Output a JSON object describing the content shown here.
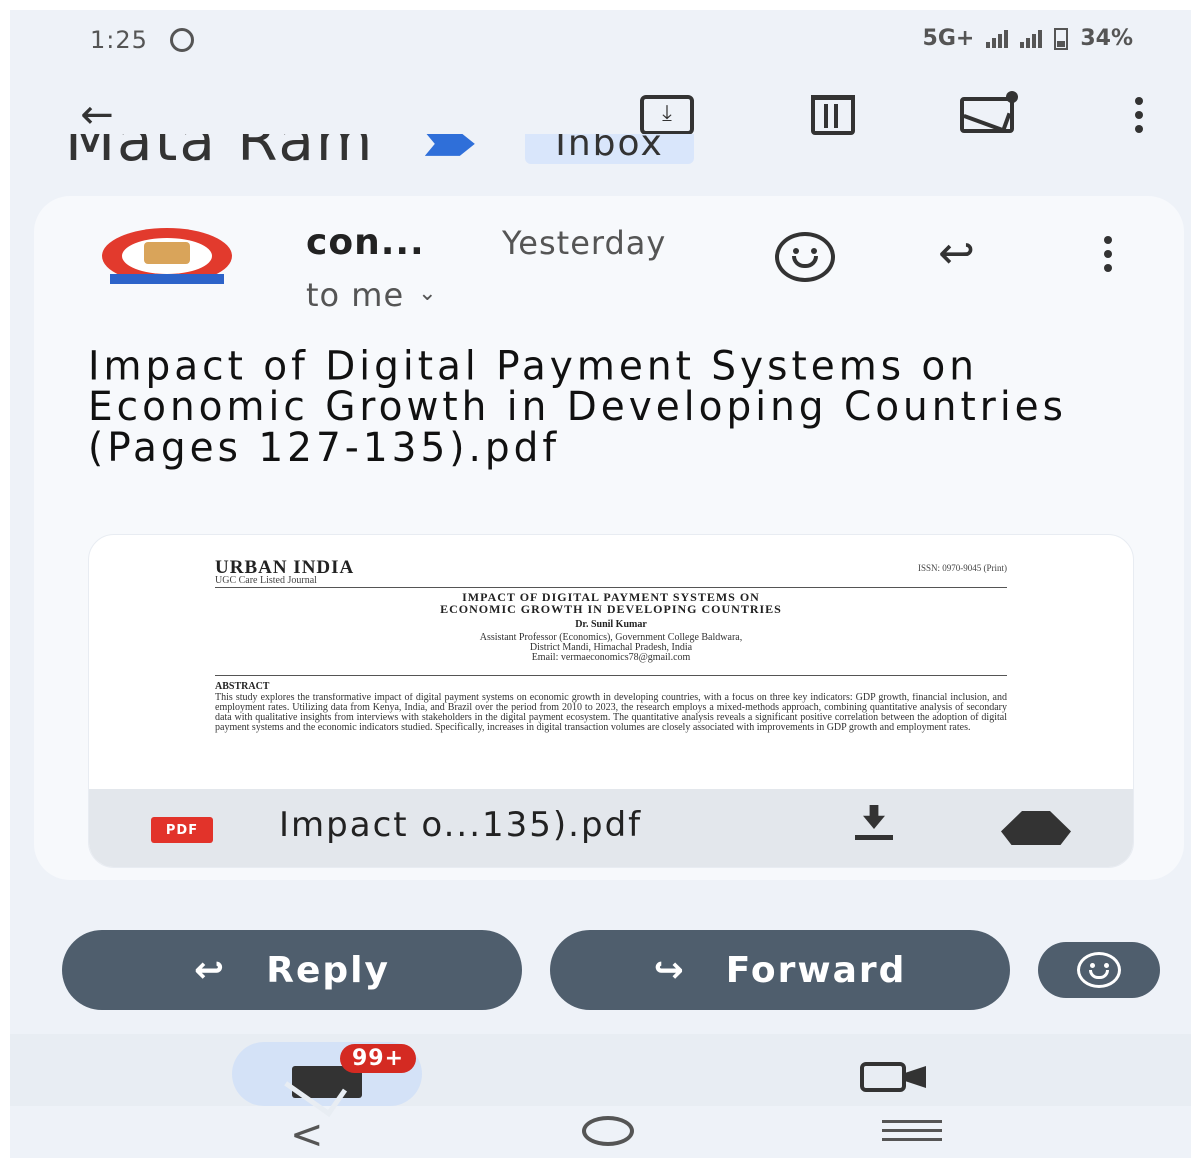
{
  "status_bar": {
    "time": "1:25",
    "indicators": "5G+",
    "battery": "34%"
  },
  "toolbar": {
    "back_icon": "arrow-back-icon",
    "archive_icon": "archive-icon",
    "delete_icon": "trash-icon",
    "mark_unread_icon": "mark-unread-icon",
    "more_icon": "more-vert-icon"
  },
  "thread": {
    "subject_peek": "Mata Ram",
    "label": "Inbox"
  },
  "message": {
    "sender": "con...",
    "date": "Yesterday",
    "recipient": "to me",
    "subject": "Impact of Digital Payment Systems on Economic Growth in Developing Countries (Pages 127-135).pdf"
  },
  "attachment": {
    "type_badge": "PDF",
    "filename": "Impact o...135).pdf",
    "preview": {
      "journal": "URBAN INDIA",
      "ugc": "UGC Care Listed Journal",
      "issn": "ISSN: 0970-9045 (Print)",
      "title_line1": "IMPACT OF DIGITAL PAYMENT SYSTEMS ON",
      "title_line2": "ECONOMIC GROWTH IN DEVELOPING COUNTRIES",
      "author": "Dr. Sunil Kumar",
      "affil_line1": "Assistant Professor (Economics), Government College Baldwara,",
      "affil_line2": "District Mandi, Himachal Pradesh, India",
      "affil_line3": "Email: vermaeconomics78@gmail.com",
      "abstract_heading": "ABSTRACT",
      "abstract_text": "This study explores the transformative impact of digital payment systems on economic growth in developing countries, with a focus on three key indicators: GDP growth, financial inclusion, and employment rates. Utilizing data from Kenya, India, and Brazil over the period from 2010 to 2023, the research employs a mixed-methods approach, combining quantitative analysis of secondary data with qualitative insights from interviews with stakeholders in the digital payment ecosystem. The quantitative analysis reveals a significant positive correlation between the adoption of digital payment systems and the economic indicators studied. Specifically, increases in digital transaction volumes are closely associated with improvements in GDP growth and employment rates."
    }
  },
  "actions": {
    "reply": "Reply",
    "forward": "Forward"
  },
  "bottom_nav": {
    "mail_badge": "99+"
  }
}
